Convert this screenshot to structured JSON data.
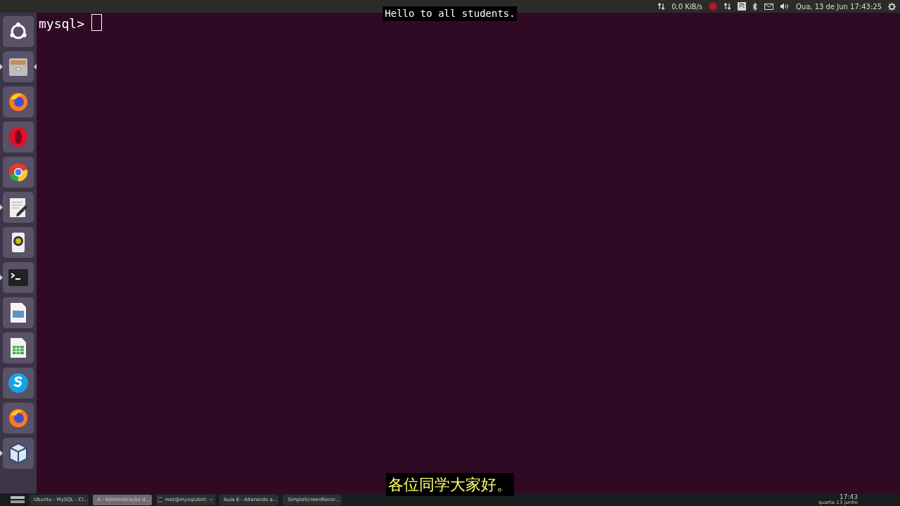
{
  "top_panel": {
    "net_speed": "0,0 KiB/s",
    "keyboard_layout": "Pt",
    "clock": "Qua, 13 de Jun 17:43:25"
  },
  "launcher": [
    {
      "kind": "ubuntu",
      "running": false,
      "focused": false
    },
    {
      "kind": "files",
      "running": true,
      "focused": true
    },
    {
      "kind": "firefox",
      "running": false,
      "focused": false
    },
    {
      "kind": "opera",
      "running": false,
      "focused": false
    },
    {
      "kind": "chrome",
      "running": false,
      "focused": false
    },
    {
      "kind": "editor",
      "running": true,
      "focused": false
    },
    {
      "kind": "speaker",
      "running": false,
      "focused": false
    },
    {
      "kind": "terminal",
      "running": true,
      "focused": false
    },
    {
      "kind": "impress",
      "running": false,
      "focused": false
    },
    {
      "kind": "calc",
      "running": false,
      "focused": false
    },
    {
      "kind": "skype",
      "running": false,
      "focused": false
    },
    {
      "kind": "firefox",
      "running": false,
      "focused": false
    },
    {
      "kind": "virtualbox",
      "running": true,
      "focused": false
    }
  ],
  "terminal": {
    "prompt": "mysql>"
  },
  "subtitles": {
    "english": "Hello to all students.",
    "chinese": "各位同学大家好。"
  },
  "taskbar": {
    "items": [
      {
        "kind": "browser",
        "label": "Ubuntu - MySQL - Cl...",
        "selected": false
      },
      {
        "kind": "files",
        "label": "4 - Administração d...",
        "selected": true
      },
      {
        "kind": "terminal",
        "label": "root@mysqlubnt: ~",
        "selected": false
      },
      {
        "kind": "editor",
        "label": "Aula 6 - Alterando a...",
        "selected": false
      },
      {
        "kind": "recorder",
        "label": "SimpleScreenRecor...",
        "selected": false
      }
    ],
    "time": "17:43",
    "date": "quarta 13 junho"
  }
}
